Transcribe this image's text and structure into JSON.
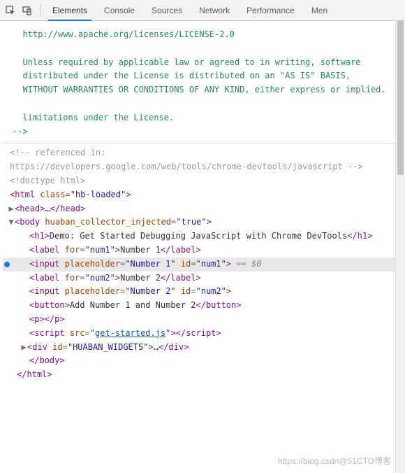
{
  "tabs": {
    "items": [
      "Elements",
      "Console",
      "Sources",
      "Network",
      "Performance",
      "Men"
    ],
    "active": 0
  },
  "comment": {
    "url": "  http://www.apache.org/licenses/LICENSE-2.0",
    "p1": "  Unless required by applicable law or agreed to in writing, software",
    "p2": "  distributed under the License is distributed on an \"AS IS\" BASIS,",
    "p3": "  WITHOUT WARRANTIES OR CONDITIONS OF ANY KIND, either express or implied.",
    "p4": "  limitations under the License.",
    "end": "-->",
    "ref1": "<!-- referenced in:",
    "ref2": "https://developers.google.com/web/tools/chrome-devtools/javascript -->",
    "doctype": "<!doctype html>"
  },
  "dom": {
    "html_class": "hb-loaded",
    "head_ellipsis": "…",
    "body_attr_name": "huaban_collector_injected",
    "body_attr_val": "true",
    "h1_text": "Demo: Get Started Debugging JavaScript with Chrome DevTools",
    "label1_for": "num1",
    "label1_text": "Number 1",
    "input1_placeholder": "Number 1",
    "input1_id": "num1",
    "selected_hint": " == $0",
    "label2_for": "num2",
    "label2_text": "Number 2",
    "input2_placeholder": "Number 2",
    "input2_id": "num2",
    "button_text": "Add Number 1 and Number 2",
    "script_src": "get-started.js",
    "widget_id": "HUABAN_WIDGETS",
    "widget_ellipsis": "…"
  },
  "watermark": "https://blog.csdn@51CTO博客"
}
